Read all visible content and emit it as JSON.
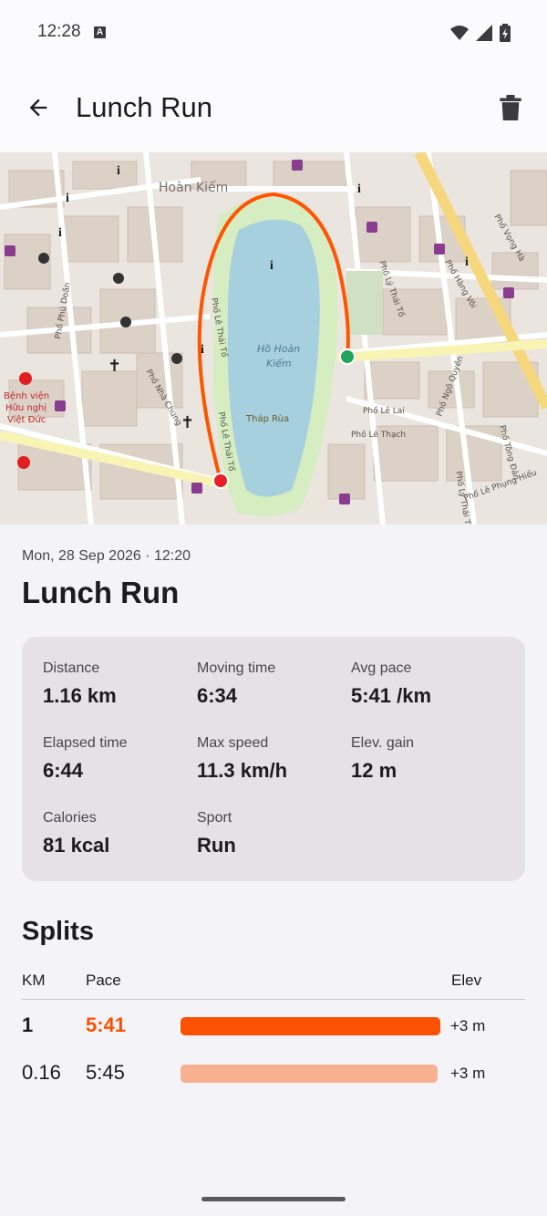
{
  "status_bar": {
    "time": "12:28",
    "badge": "A"
  },
  "app_bar": {
    "title": "Lunch Run",
    "back_icon": "arrow-back-icon",
    "delete_icon": "trash-icon"
  },
  "map": {
    "labels": {
      "hoan_kiem": "Hoàn Kiếm",
      "lake": "Hồ Hoàn",
      "lake2": "Kiếm",
      "thap_rua": "Tháp Rùa",
      "street1": "Phố Lê Thái Tổ",
      "street2": "Phố Lê Thái Tổ",
      "le_lai": "Phố Lê Lai",
      "le_thach": "Phố Lê Thạch",
      "ly_thai_to": "Phố Lý Thái Tổ",
      "nha_chung": "Phố Nhà Chung",
      "hospital1": "Bệnh viện",
      "hospital2": "Hữu nghị",
      "hospital3": "Việt Đức",
      "phu_doan": "Phố Phủ Doãn",
      "ngo_quyen": "Phố Ngô Quyền",
      "hang_voi": "Phố Hàng Vôi",
      "vong_ha": "Phố Vọng Hà",
      "trang_tien": "Phố Tông Đản",
      "le_phung_hieu": "Phố Lê Phụng Hiểu",
      "ly_thai_to2": "Phố Lý Thái Tổ"
    },
    "route_color": "#ff5500",
    "start_color": "#22a45d",
    "end_color": "#e8202a"
  },
  "run": {
    "date": "Mon, 28 Sep 2026 · 12:20",
    "title": "Lunch Run"
  },
  "stats": [
    {
      "label": "Distance",
      "value": "1.16 km"
    },
    {
      "label": "Moving time",
      "value": "6:34"
    },
    {
      "label": "Avg pace",
      "value": "5:41 /km"
    },
    {
      "label": "Elapsed time",
      "value": "6:44"
    },
    {
      "label": "Max speed",
      "value": "11.3 km/h"
    },
    {
      "label": "Elev. gain",
      "value": "12 m"
    },
    {
      "label": "Calories",
      "value": "81 kcal"
    },
    {
      "label": "Sport",
      "value": "Run"
    }
  ],
  "splits": {
    "title": "Splits",
    "headers": {
      "km": "KM",
      "pace": "Pace",
      "elev": "Elev"
    },
    "rows": [
      {
        "km": "1",
        "pace": "5:41",
        "elev": "+3 m",
        "bar_fraction": 1.0,
        "bar_color": "#fc5200",
        "highlight": true
      },
      {
        "km": "0.16",
        "pace": "5:45",
        "elev": "+3 m",
        "bar_fraction": 0.99,
        "bar_color": "#f8b190",
        "highlight": false
      }
    ]
  },
  "accent_color": "#fc5200"
}
